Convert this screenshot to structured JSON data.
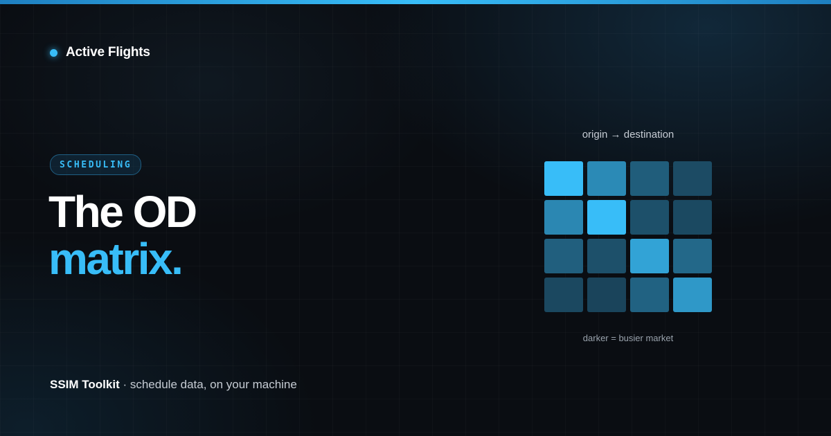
{
  "brand": {
    "name": "Active Flights",
    "accent": "#38bdf8"
  },
  "tag": "SCHEDULING",
  "headline": {
    "line1": "The OD",
    "line2": "matrix."
  },
  "footer": {
    "product": "SSIM Toolkit",
    "tagline": " · schedule data, on your machine"
  },
  "matrix": {
    "caption": "origin → destination",
    "note": "darker = busier market",
    "rows": [
      [
        1.0,
        0.72,
        0.42,
        0.28
      ],
      [
        0.7,
        1.0,
        0.32,
        0.26
      ],
      [
        0.44,
        0.32,
        0.86,
        0.5
      ],
      [
        0.25,
        0.22,
        0.46,
        0.8
      ]
    ]
  }
}
